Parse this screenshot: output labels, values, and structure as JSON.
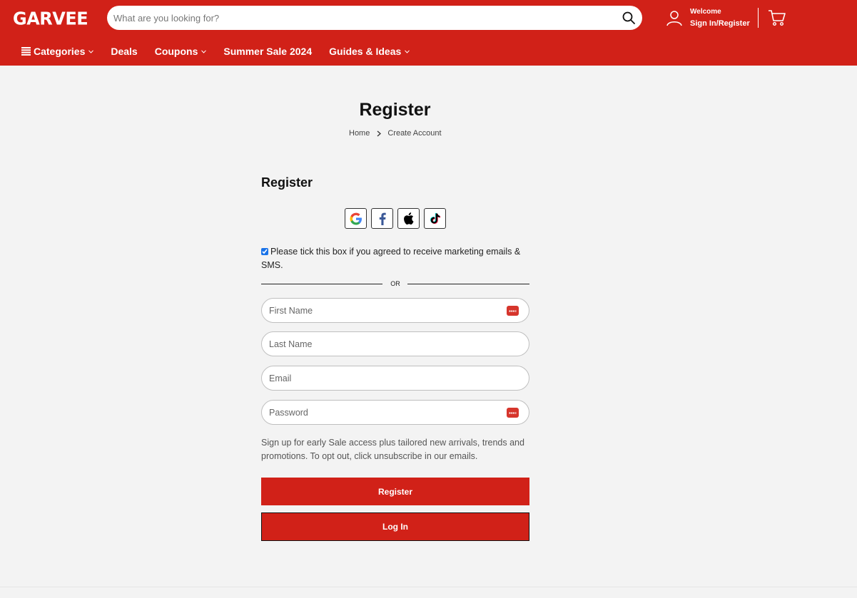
{
  "header": {
    "logo": "GARVEE",
    "search_placeholder": "What are you looking for?",
    "welcome": "Welcome",
    "signin": "Sign In/Register",
    "icons": [
      "search-icon",
      "user-icon",
      "cart-icon"
    ]
  },
  "nav": {
    "items": [
      {
        "label": "Categories",
        "dropdown": true,
        "icon": "menu-icon"
      },
      {
        "label": "Deals",
        "dropdown": false
      },
      {
        "label": "Coupons",
        "dropdown": true
      },
      {
        "label": "Summer Sale 2024",
        "dropdown": false
      },
      {
        "label": "Guides & Ideas",
        "dropdown": true
      }
    ]
  },
  "page": {
    "title": "Register",
    "breadcrumb": [
      "Home",
      "Create Account"
    ]
  },
  "form": {
    "title": "Register",
    "social": [
      "google-icon",
      "facebook-icon",
      "apple-icon",
      "tiktok-icon"
    ],
    "consent_checked": true,
    "consent_text": "Please tick this box if you agreed to receive marketing emails & SMS.",
    "or_text": "OR",
    "fields": {
      "first_name": {
        "placeholder": "First Name",
        "value": ""
      },
      "last_name": {
        "placeholder": "Last Name",
        "value": ""
      },
      "email": {
        "placeholder": "Email",
        "value": ""
      },
      "password": {
        "placeholder": "Password",
        "value": ""
      }
    },
    "info_text": "Sign up for early Sale access plus tailored new arrivals, trends and promotions. To opt out, click unsubscribe in our emails.",
    "register_button": "Register",
    "login_button": "Log In"
  },
  "colors": {
    "brand": "#d12118",
    "background": "#f3f3f3"
  }
}
